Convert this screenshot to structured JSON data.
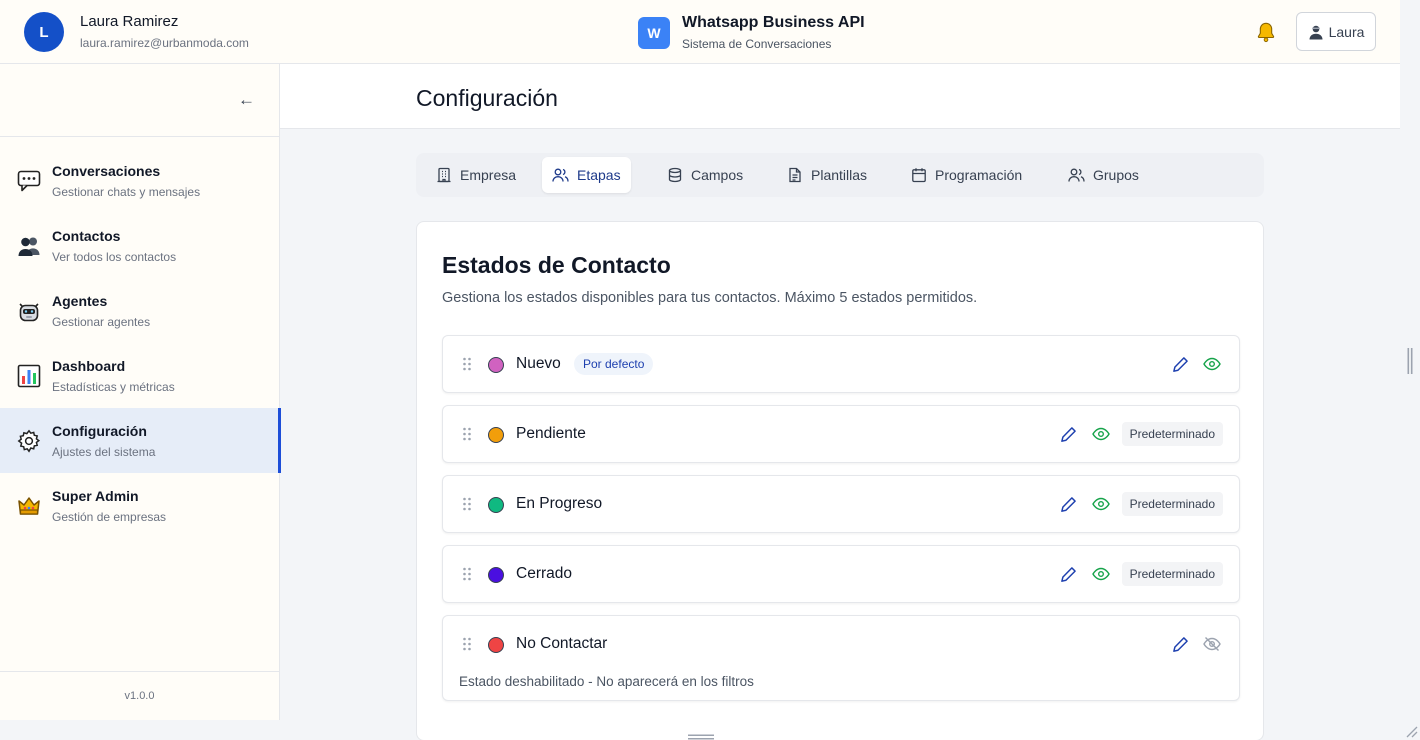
{
  "header": {
    "user_initial": "L",
    "user_name": "Laura Ramirez",
    "user_email": "laura.ramirez@urbanmoda.com",
    "brand_initial": "W",
    "brand_title": "Whatsapp Business API",
    "brand_subtitle": "Sistema de Conversaciones",
    "user_button_label": "Laura"
  },
  "sidebar": {
    "collapse_label": "←",
    "items": [
      {
        "label": "Conversaciones",
        "desc": "Gestionar chats y mensajes",
        "icon": "speech-bubble-icon"
      },
      {
        "label": "Contactos",
        "desc": "Ver todos los contactos",
        "icon": "people-icon"
      },
      {
        "label": "Agentes",
        "desc": "Gestionar agentes",
        "icon": "robot-icon"
      },
      {
        "label": "Dashboard",
        "desc": "Estadísticas y métricas",
        "icon": "bar-chart-icon"
      },
      {
        "label": "Configuración",
        "desc": "Ajustes del sistema",
        "icon": "gear-icon"
      },
      {
        "label": "Super Admin",
        "desc": "Gestión de empresas",
        "icon": "crown-icon"
      }
    ],
    "active_index": 4,
    "version": "v1.0.0"
  },
  "page": {
    "title": "Configuración"
  },
  "tabs": [
    {
      "label": "Empresa",
      "icon": "building-icon"
    },
    {
      "label": "Etapas",
      "icon": "users-icon"
    },
    {
      "label": "Campos",
      "icon": "database-icon"
    },
    {
      "label": "Plantillas",
      "icon": "file-icon"
    },
    {
      "label": "Programación",
      "icon": "calendar-icon"
    },
    {
      "label": "Grupos",
      "icon": "users-icon"
    }
  ],
  "active_tab": 1,
  "states_card": {
    "title": "Estados de Contacto",
    "description": "Gestiona los estados disponibles para tus contactos. Máximo 5 estados permitidos.",
    "default_badge_label": "Por defecto",
    "predefined_label": "Predeterminado",
    "states": [
      {
        "name": "Nuevo",
        "color": "#d062c0",
        "is_default": true,
        "predefined": false,
        "enabled": true,
        "note": ""
      },
      {
        "name": "Pendiente",
        "color": "#f29e0b",
        "is_default": false,
        "predefined": true,
        "enabled": true,
        "note": ""
      },
      {
        "name": "En Progreso",
        "color": "#10b981",
        "is_default": false,
        "predefined": true,
        "enabled": true,
        "note": ""
      },
      {
        "name": "Cerrado",
        "color": "#4a0fe0",
        "is_default": false,
        "predefined": true,
        "enabled": true,
        "note": ""
      },
      {
        "name": "No Contactar",
        "color": "#ef4444",
        "is_default": false,
        "predefined": false,
        "enabled": false,
        "note": "Estado deshabilitado - No aparecerá en los filtros"
      }
    ]
  },
  "colors": {
    "accent": "#1d4ed8",
    "edit_icon": "#2563eb",
    "visible_icon": "#16a34a",
    "hidden_icon": "#9ca3af"
  }
}
